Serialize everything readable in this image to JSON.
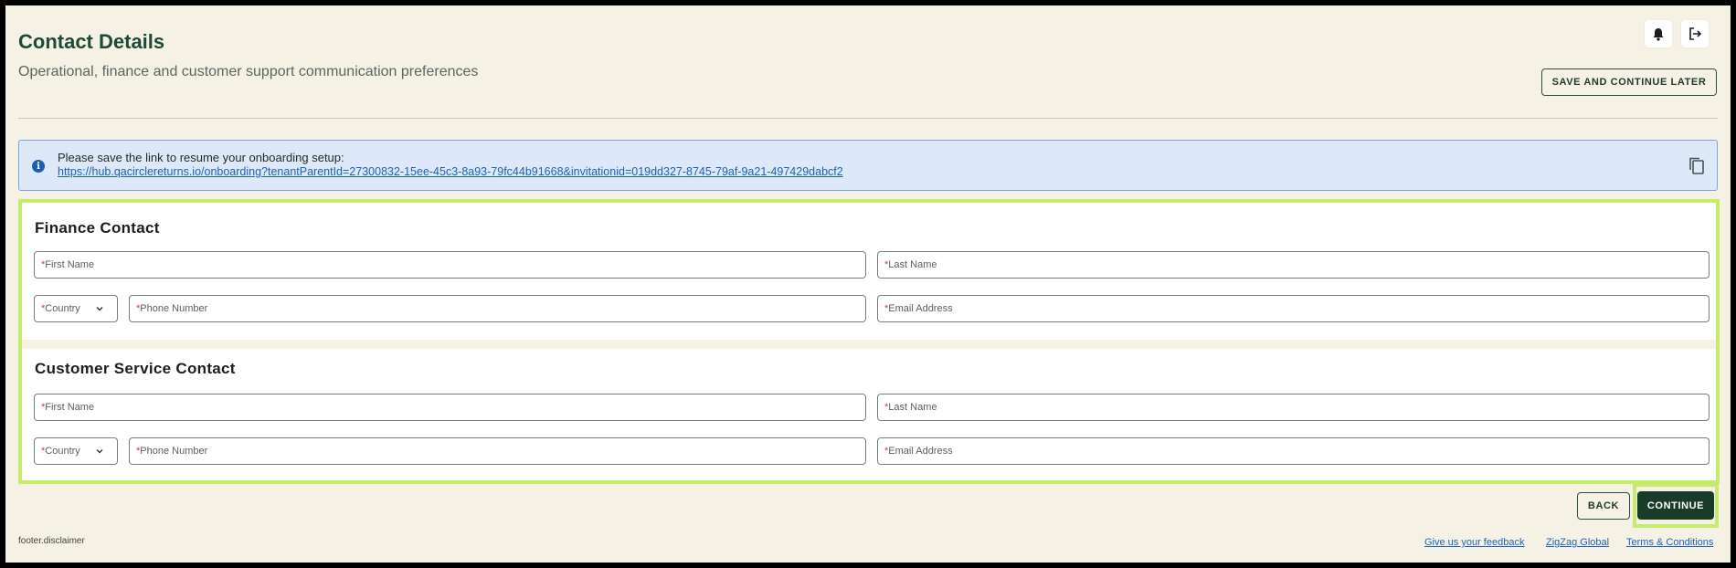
{
  "header": {
    "title": "Contact Details",
    "subtitle": "Operational, finance and customer support communication preferences",
    "save_later_label": "SAVE AND CONTINUE LATER"
  },
  "icons": {
    "bell": "bell-icon",
    "logout": "logout-icon",
    "info": "info-icon",
    "copy": "copy-icon"
  },
  "banner": {
    "message": "Please save the link to resume your onboarding setup:",
    "link": "https://hub.qacirclereturns.io/onboarding?tenantParentId=27300832-15ee-45c3-8a93-79fc44b91668&invitationid=019dd327-8745-79af-9a21-497429dabcf2"
  },
  "finance": {
    "title": "Finance Contact",
    "first_name": "First Name",
    "last_name": "Last Name",
    "country": "Country",
    "phone": "Phone Number",
    "email": "Email Address"
  },
  "customer": {
    "title": "Customer Service Contact",
    "first_name": "First Name",
    "last_name": "Last Name",
    "country": "Country",
    "phone": "Phone Number",
    "email": "Email Address"
  },
  "required_marker": "*",
  "actions": {
    "back": "BACK",
    "continue": "CONTINUE"
  },
  "footer": {
    "disclaimer": "footer.disclaimer",
    "feedback": "Give us your feedback",
    "company": "ZigZag Global",
    "terms": "Terms & Conditions"
  },
  "colors": {
    "background": "#f6f1e5",
    "primary": "#193c29",
    "highlight": "#c6ea6a",
    "link": "#1c63b8",
    "banner": "#dde9f9"
  }
}
